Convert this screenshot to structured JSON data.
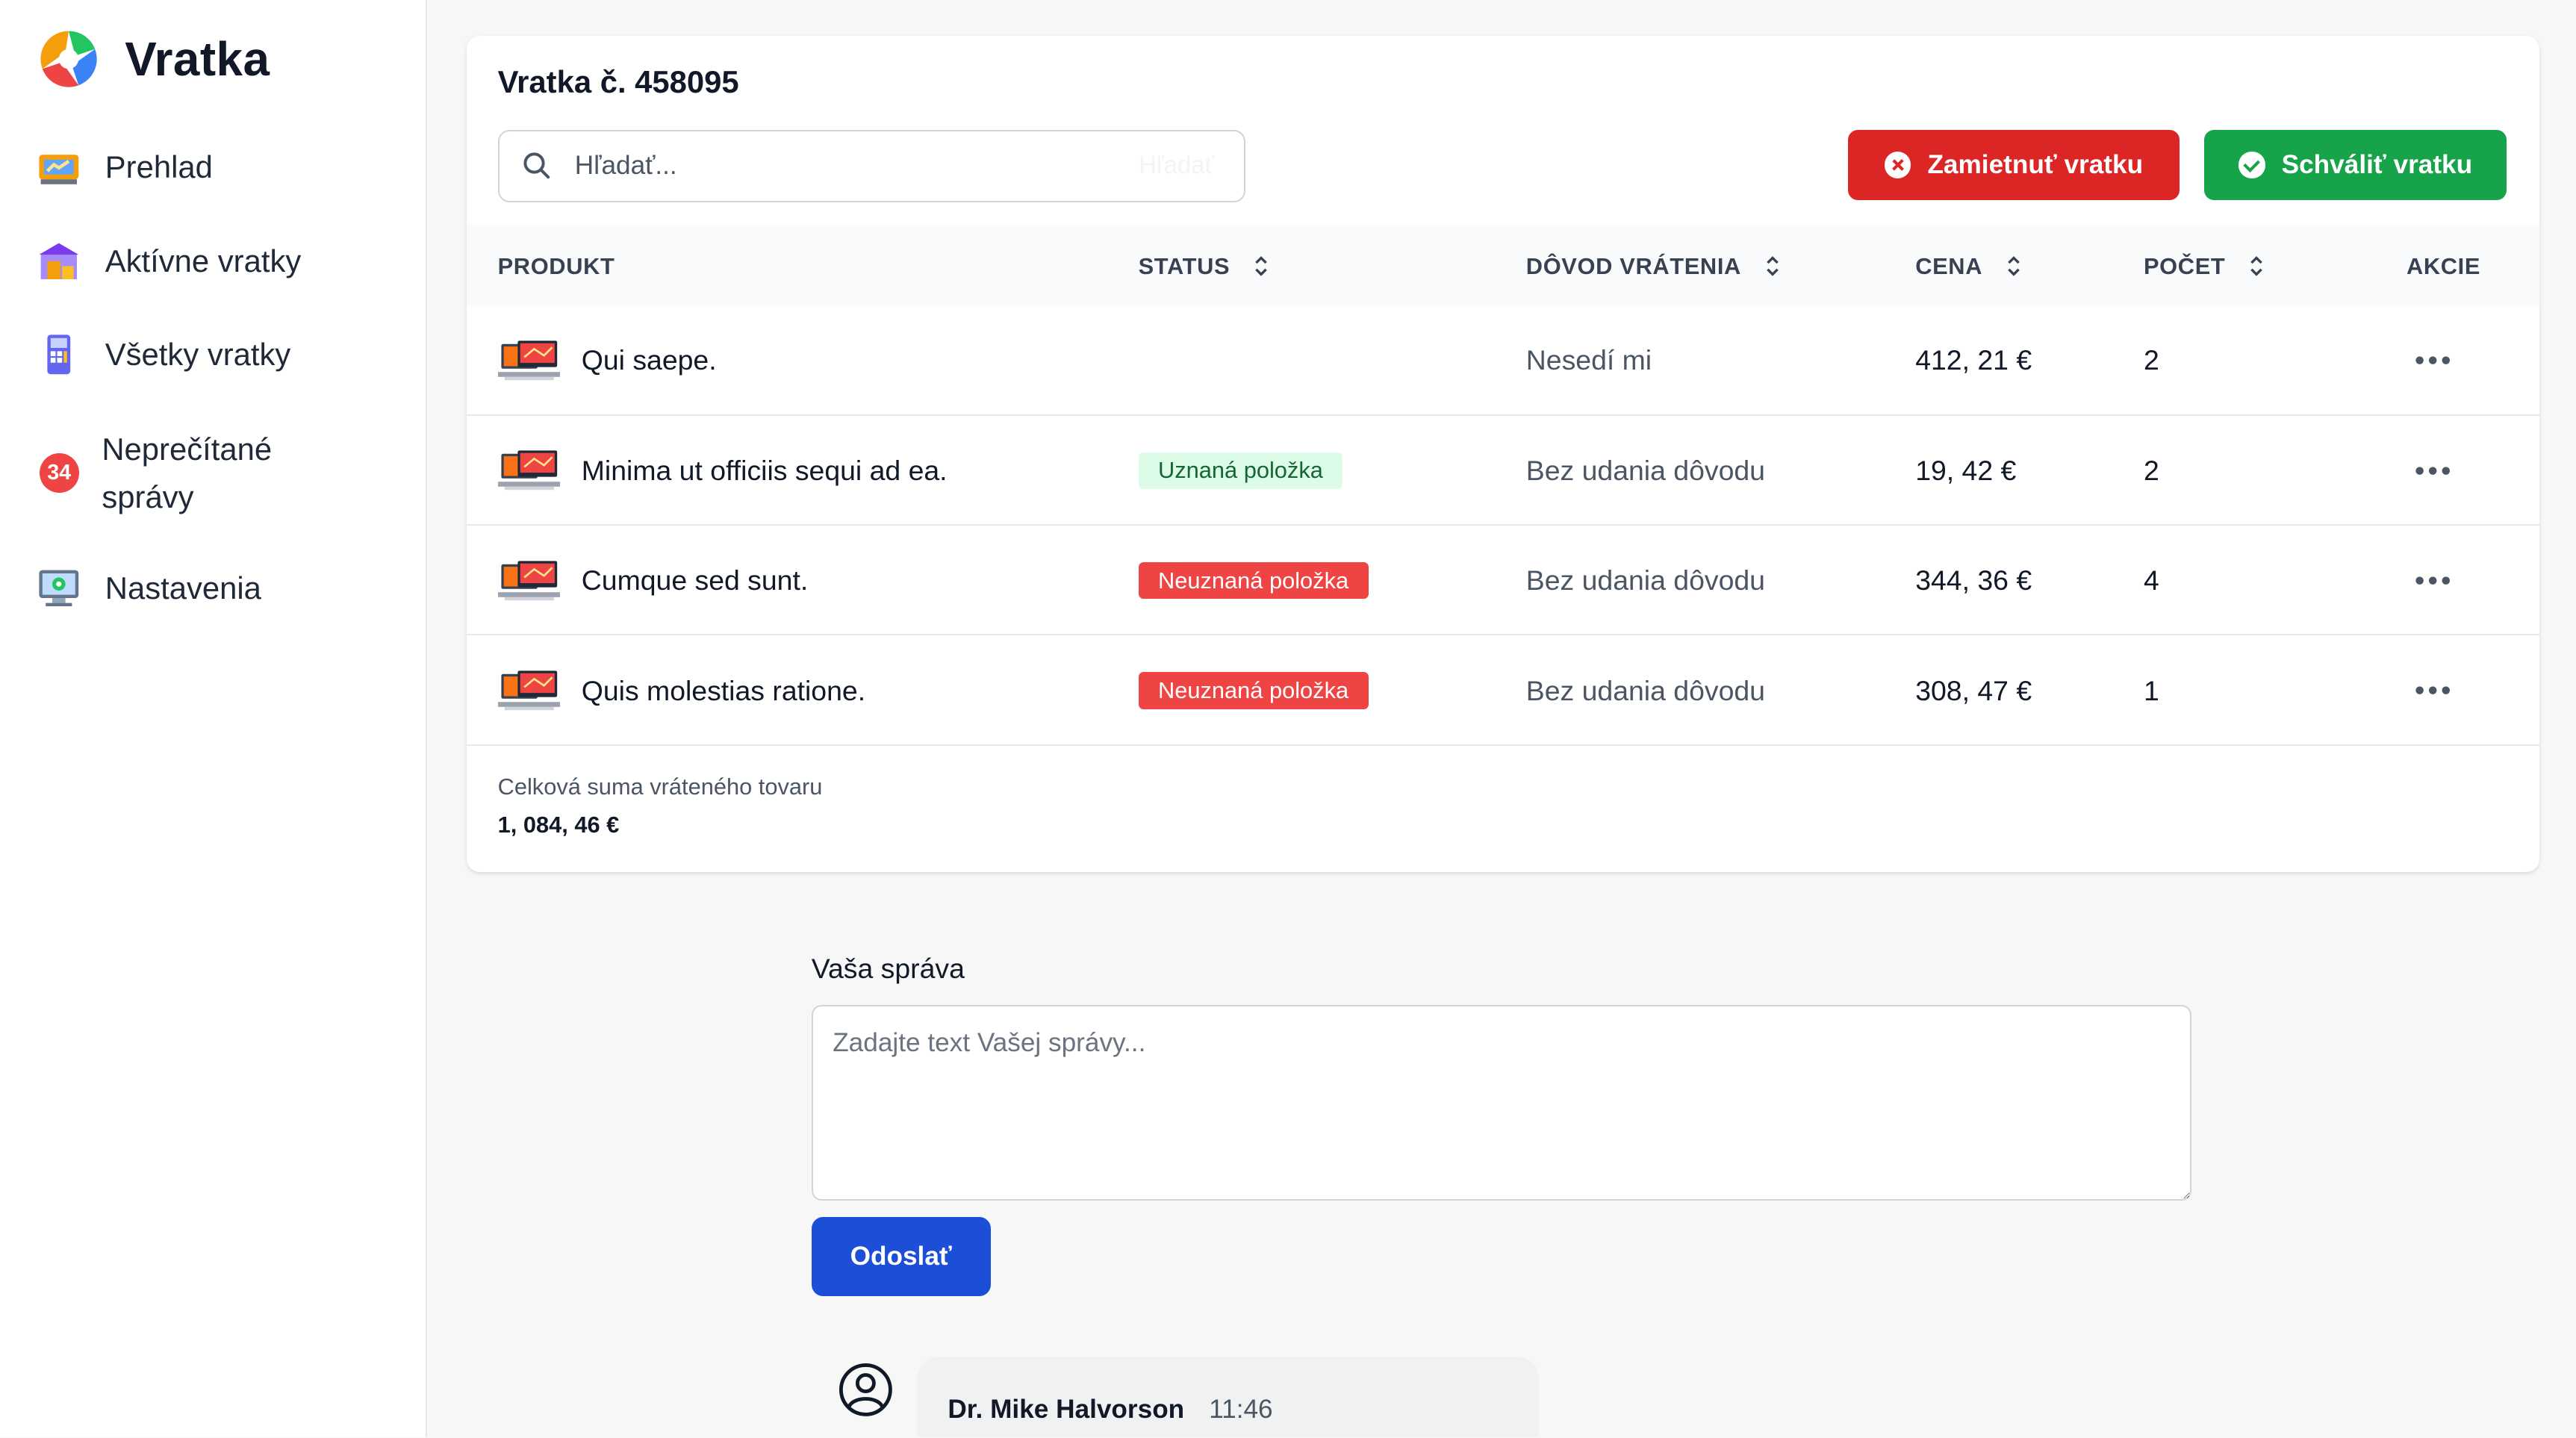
{
  "app": {
    "name": "Vratka"
  },
  "sidebar": {
    "items": [
      {
        "label": "Prehlad",
        "icon": "dashboard-icon"
      },
      {
        "label": "Aktívne vratky",
        "icon": "warehouse-icon"
      },
      {
        "label": "Všetky vratky",
        "icon": "terminal-icon"
      },
      {
        "label": "Neprečítané správy",
        "icon": "unread-badge",
        "badge": "34"
      },
      {
        "label": "Nastavenia",
        "icon": "monitor-settings-icon"
      }
    ]
  },
  "order": {
    "title": "Vratka č. 458095",
    "search_placeholder": "Hľadať...",
    "search_button": "Hľadať",
    "reject_label": "Zamietnuť vratku",
    "approve_label": "Schváliť vratku"
  },
  "table": {
    "headers": {
      "product": "PRODUKT",
      "status": "STATUS",
      "reason": "DÔVOD VRÁTENIA",
      "price": "CENA",
      "qty": "POČET",
      "actions": "AKCIE"
    },
    "rows": [
      {
        "product": "Qui saepe.",
        "status": "",
        "status_type": "none",
        "reason": "Nesedí mi",
        "price": "412, 21 €",
        "qty": "2"
      },
      {
        "product": "Minima ut officiis sequi ad ea.",
        "status": "Uznaná položka",
        "status_type": "approved",
        "reason": "Bez udania dôvodu",
        "price": "19, 42 €",
        "qty": "2"
      },
      {
        "product": "Cumque sed sunt.",
        "status": "Neuznaná položka",
        "status_type": "rejected",
        "reason": "Bez udania dôvodu",
        "price": "344, 36 €",
        "qty": "4"
      },
      {
        "product": "Quis molestias ratione.",
        "status": "Neuznaná položka",
        "status_type": "rejected",
        "reason": "Bez udania dôvodu",
        "price": "308, 47 €",
        "qty": "1"
      }
    ],
    "total_label": "Celková suma vráteného tovaru",
    "total_value": "1, 084, 46 €"
  },
  "message": {
    "label": "Vaša správa",
    "placeholder": "Zadajte text Vašej správy...",
    "send_label": "Odoslať"
  },
  "comment": {
    "author": "Dr. Mike Halvorson",
    "time": "11:46"
  },
  "colors": {
    "reject": "#dc2626",
    "approve": "#16a34a",
    "send": "#1d4ed8",
    "badge": "#ef4444"
  }
}
